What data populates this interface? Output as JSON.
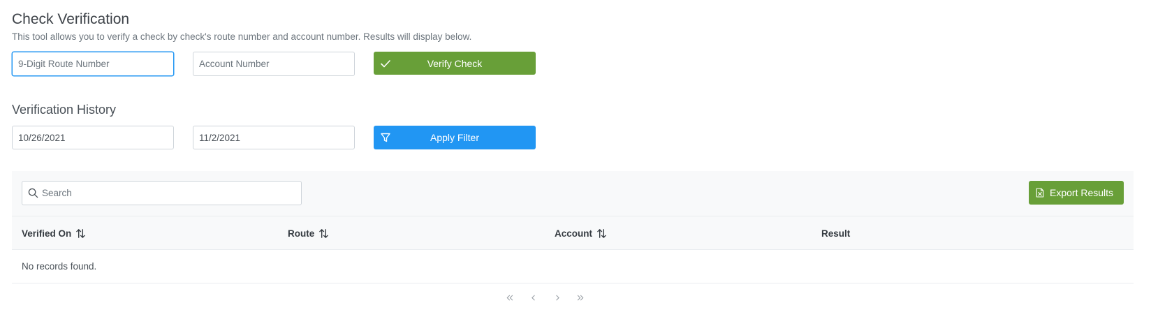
{
  "header": {
    "title": "Check Verification",
    "description": "This tool allows you to verify a check by check's route number and account number. Results will display below."
  },
  "verify_form": {
    "route_placeholder": "9-Digit Route Number",
    "route_value": "",
    "account_placeholder": "Account Number",
    "account_value": "",
    "verify_label": "Verify Check",
    "verify_icon": "check-icon"
  },
  "history": {
    "title": "Verification History",
    "start_date": "10/26/2021",
    "end_date": "11/2/2021",
    "filter_label": "Apply Filter",
    "filter_icon": "filter-icon"
  },
  "table": {
    "search_placeholder": "Search",
    "search_value": "",
    "export_label": "Export Results",
    "export_icon": "excel-file-icon",
    "columns": [
      {
        "label": "Verified On",
        "sortable": true
      },
      {
        "label": "Route",
        "sortable": true
      },
      {
        "label": "Account",
        "sortable": true
      },
      {
        "label": "Result",
        "sortable": false
      }
    ],
    "rows": [],
    "empty_message": "No records found."
  },
  "pagination": {
    "first_icon": "double-chevron-left-icon",
    "prev_icon": "chevron-left-icon",
    "next_icon": "chevron-right-icon",
    "last_icon": "double-chevron-right-icon"
  },
  "colors": {
    "green": "#689f38",
    "blue": "#2196f3",
    "focus_border": "#2196f3",
    "toolbar_bg": "#f8f9fa"
  }
}
